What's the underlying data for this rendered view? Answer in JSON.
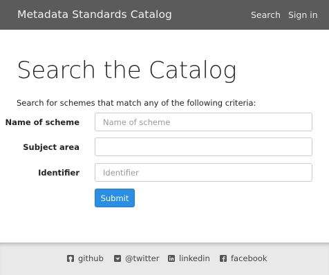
{
  "navbar": {
    "brand": "Metadata Standards Catalog",
    "links": [
      "Search",
      "Sign in"
    ]
  },
  "main": {
    "title": "Search the Catalog",
    "intro": "Search for schemes that match any of the following criteria:",
    "fields": [
      {
        "label": "Name of scheme",
        "placeholder": "Name of scheme",
        "value": ""
      },
      {
        "label": "Subject area",
        "placeholder": "",
        "value": ""
      },
      {
        "label": "Identifier",
        "placeholder": "Identifier",
        "value": ""
      }
    ],
    "submit_label": "Submit"
  },
  "footer": {
    "links": [
      {
        "label": "github",
        "icon": "github-icon"
      },
      {
        "label": "@twitter",
        "icon": "twitter-icon"
      },
      {
        "label": "linkedin",
        "icon": "linkedin-icon"
      },
      {
        "label": "facebook",
        "icon": "facebook-icon"
      }
    ]
  },
  "colors": {
    "navbar_bg": "#5b5b5b",
    "accent": "#2a8ee6",
    "footer_bg": "#e9e9e9"
  }
}
